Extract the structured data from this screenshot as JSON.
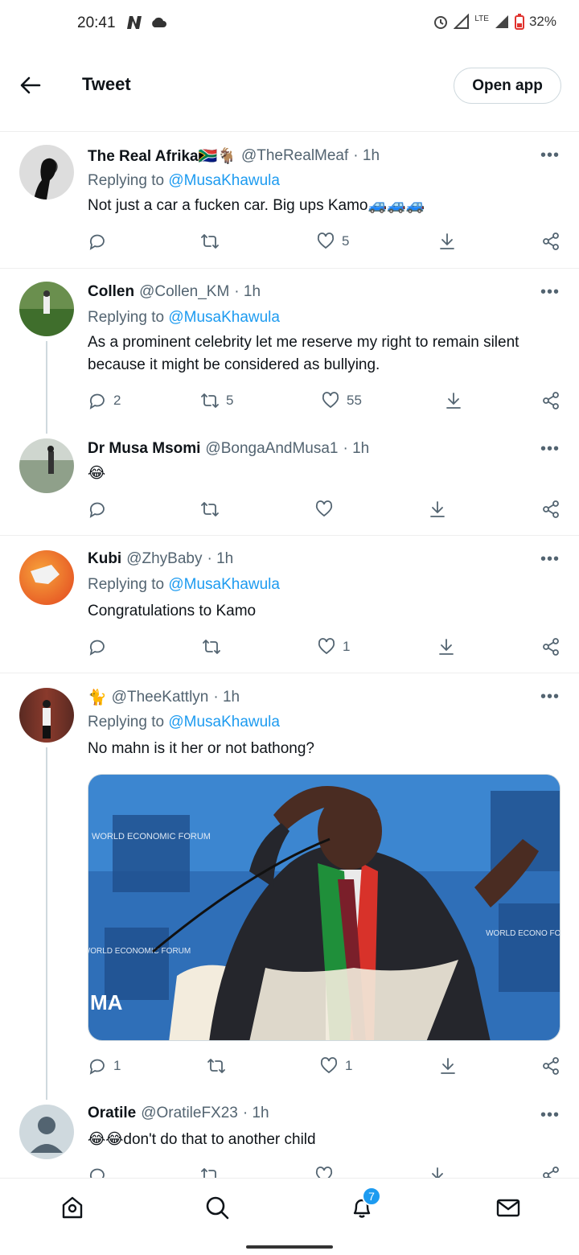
{
  "status_bar": {
    "time": "20:41",
    "network": "LTE",
    "battery": "32%"
  },
  "header": {
    "title": "Tweet",
    "open_app": "Open app"
  },
  "replying_to_label": "Replying to",
  "tweets": [
    {
      "name": "The Real Afrika🇿🇦🐐",
      "handle": "@TheRealMeaf",
      "time": "· 1h",
      "reply_to": "@MusaKhawula",
      "text": "Not just a car a fucken car. Big ups Kamo🚙🚙🚙",
      "replies": "",
      "retweets": "",
      "likes": "5"
    },
    {
      "name": "Collen",
      "handle": "@Collen_KM",
      "time": "· 1h",
      "reply_to": "@MusaKhawula",
      "text": "As a prominent celebrity let me reserve my right to remain silent because it might be considered as bullying.",
      "replies": "2",
      "retweets": "5",
      "likes": "55"
    },
    {
      "name": "Dr Musa Msomi",
      "handle": "@BongaAndMusa1",
      "time": "· 1h",
      "reply_to": "",
      "text": "😂",
      "replies": "",
      "retweets": "",
      "likes": ""
    },
    {
      "name": "Kubi",
      "handle": "@ZhyBaby",
      "time": "· 1h",
      "reply_to": "@MusaKhawula",
      "text": "Congratulations to Kamo",
      "replies": "",
      "retweets": "",
      "likes": "1"
    },
    {
      "name": "🐈",
      "handle": "@TheeKattlyn",
      "time": "· 1h",
      "reply_to": "@MusaKhawula",
      "text": "No mahn is it her or not bathong?",
      "replies": "1",
      "retweets": "",
      "likes": "1"
    },
    {
      "name": "Oratile",
      "handle": "@OratileFX23",
      "time": "· 1h",
      "reply_to": "",
      "text": "😂😂don't do that to another child",
      "replies": "",
      "retweets": "",
      "likes": ""
    }
  ],
  "media": {
    "banner_text_1": "WORLD ECONOMIC FORUM",
    "banner_text_2": "WORLD ECONOMIC FORUM",
    "banner_text_3": "WORLD ECONO FORU",
    "corner_text": "MA"
  },
  "bottom_nav": {
    "notification_count": "7"
  },
  "colors": {
    "accent": "#1d9bf0",
    "text": "#0f1419",
    "secondary": "#536471",
    "border": "#eeeeee"
  }
}
